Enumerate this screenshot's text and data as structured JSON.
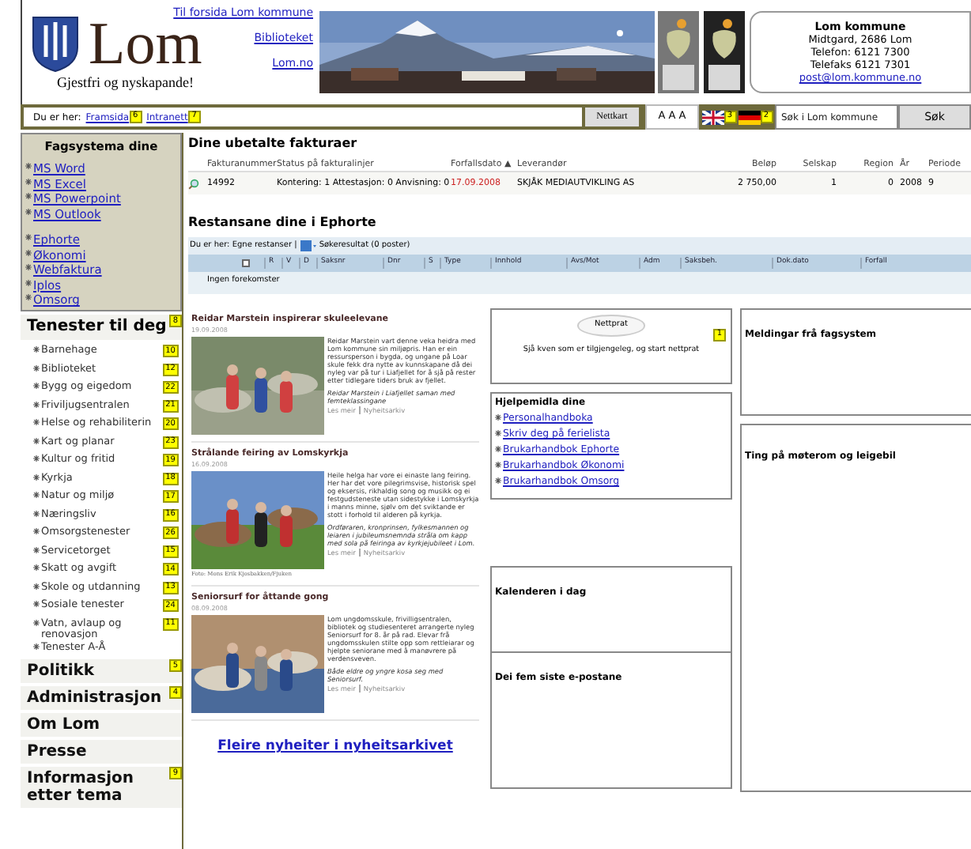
{
  "header": {
    "logo_text": "Lom",
    "tagline": "Gjestfri og nyskapande!",
    "links": [
      "Til forsida Lom kommune",
      "Biblioteket",
      "Lom.no"
    ],
    "address": {
      "name": "Lom kommune",
      "lines": [
        "Midtgard, 2686 Lom",
        "Telefon: 6121 7300",
        "Telefaks 6121 7301"
      ],
      "email": "post@lom.kommune.no"
    }
  },
  "breadcrumb": {
    "label": "Du er her:",
    "links": [
      {
        "text": "Framsida",
        "badge": "6"
      },
      {
        "text": "Intranett",
        "badge": "7"
      }
    ]
  },
  "toolbar": {
    "sitemap": "Nettkart",
    "text_size": "A A A",
    "flags": [
      {
        "kind": "uk",
        "badge": "3"
      },
      {
        "kind": "de",
        "badge": "2"
      }
    ],
    "search_placeholder": "Søk i Lom kommune",
    "search_button": "Søk"
  },
  "fagsystem": {
    "title": "Fagsystema dine",
    "groups": [
      [
        "MS Word",
        "MS Excel",
        "MS Powerpoint",
        "MS Outlook"
      ],
      [
        "Ephorte",
        "Økonomi",
        "Webfaktura",
        "Iplos",
        "Omsorg"
      ]
    ]
  },
  "services": {
    "title": "Tenester til deg",
    "badge": "8",
    "items": [
      {
        "label": "Barnehage",
        "badge": "10"
      },
      {
        "label": "Biblioteket",
        "badge": "12"
      },
      {
        "label": "Bygg og eigedom",
        "badge": "22"
      },
      {
        "label": "Friviljugsentralen",
        "badge": "21"
      },
      {
        "label": "Helse og rehabiliterin",
        "badge": "20"
      },
      {
        "label": "Kart og planar",
        "badge": "23"
      },
      {
        "label": "Kultur og fritid",
        "badge": "19"
      },
      {
        "label": "Kyrkja",
        "badge": "18"
      },
      {
        "label": "Natur og miljø",
        "badge": "17"
      },
      {
        "label": "Næringsliv",
        "badge": "16"
      },
      {
        "label": "Omsorgstenester",
        "badge": "26"
      },
      {
        "label": "Servicetorget",
        "badge": "15"
      },
      {
        "label": "Skatt og avgift",
        "badge": "14"
      },
      {
        "label": "Skole og utdanning",
        "badge": "13"
      },
      {
        "label": "Sosiale tenester",
        "badge": "24"
      },
      {
        "label": "Vatn, avlaup og renovasjon",
        "badge": "11"
      },
      {
        "label": "Tenester A-Å"
      }
    ]
  },
  "sections": [
    {
      "label": "Politikk",
      "badge": "5"
    },
    {
      "label": "Administrasjon",
      "badge": "4"
    },
    {
      "label": "Om Lom"
    },
    {
      "label": "Presse"
    },
    {
      "label": "Informasjon etter tema",
      "badge": "9"
    }
  ],
  "invoices": {
    "title": "Dine ubetalte fakturaer",
    "columns": [
      "Fakturanummer",
      "Status på fakturalinjer",
      "Forfallsdato ▲",
      "Leverandør",
      "Beløp",
      "Selskap",
      "Region",
      "År",
      "Periode"
    ],
    "rows": [
      {
        "overdue": true,
        "cells": [
          "14992",
          "Kontering: 1 Attestasjon: 0 Anvisning: 0",
          "17.09.2008",
          "SKJÅK MEDIAUTVIKLING AS",
          "2 750,00",
          "1",
          "0",
          "2008",
          "9"
        ]
      }
    ]
  },
  "ephorte": {
    "title": "Restansane dine i Ephorte",
    "breadcrumb": "Du er her: Egne restanser |",
    "result": "Søkeresultat (0 poster)",
    "select_all": {
      "checked": false
    },
    "columns": [
      "R",
      "V",
      "D",
      "Saksnr",
      "Dnr",
      "S",
      "Type",
      "Innhold",
      "Avs/Mot",
      "Adm",
      "Saksbeh.",
      "Dok.dato",
      "Forfall"
    ],
    "empty": "Ingen forekomster"
  },
  "news": {
    "items": [
      {
        "title": "Reidar Marstein inspirerar skuleelevane",
        "date": "19.09.2008",
        "body": "Reidar Marstein vart denne veka heidra med Lom kommune sin miljøpris. Han er ein ressursperson i bygda, og ungane på Loar skule fekk dra nytte av kunnskapane då dei nyleg var på tur i Liafjellet for å sjå på rester etter tidlegare tiders bruk av fjellet.",
        "caption": "Reidar Marstein i Liafjellet saman med femteklassingane",
        "more": "Les meir",
        "archive": "Nyheitsarkiv"
      },
      {
        "title": "Strålande feiring av Lomskyrkja",
        "date": "16.09.2008",
        "body": "Heile helga har vore ei einaste lang feiring. Her har det vore pilegrimsvise, historisk spel og eksersis, rikhaldig song og musikk og ei festgudsteneste utan sidestykke i Lomskyrkja i manns minne, sjølv om det sviktande er stott i forhold til alderen på kyrkja.",
        "caption": "Ordføraren, kronprinsen, fylkesmannen og leiaren i jubileumsnemnda stråla om kapp med sola på feiringa av kyrkjejubileet i Lom.",
        "credit": "Foto: Mons Erik Kjosbakken/Fjuken",
        "more": "Les meir",
        "archive": "Nyheitsarkiv"
      },
      {
        "title": "Seniorsurf for åttande gong",
        "date": "08.09.2008",
        "body": "Lom ungdomsskule, frivilligsentralen, bibliotek og studiesenteret arrangerte nyleg Seniorsurf for 8. år på rad. Elevar frå ungdomsskulen stilte opp som rettleiarar og hjelpte seniorane med å manøvrere på verdensveven.",
        "caption": "Både eldre og yngre kosa seg med Seniorsurf.",
        "more": "Les meir",
        "archive": "Nyheitsarkiv"
      }
    ],
    "archive_link": "Fleire nyheiter i nyheitsarkivet"
  },
  "chat": {
    "bubble": "Nettprat",
    "badge": "1",
    "text": "Sjå kven som er tilgjengeleg, og start nettprat"
  },
  "tools": {
    "title": "Hjelpemidla dine",
    "links": [
      "Personalhandboka",
      "Skriv deg på ferielista",
      "Brukarhandbok Ephorte",
      "Brukarhandbok Økonomi",
      "Brukarhandbok Omsorg"
    ]
  },
  "panels": {
    "calendar": "Kalenderen i dag",
    "emails": "Dei fem siste e-postane",
    "messages": "Meldingar frå fagsystem",
    "booking": "Ting på møterom og leigebil"
  }
}
